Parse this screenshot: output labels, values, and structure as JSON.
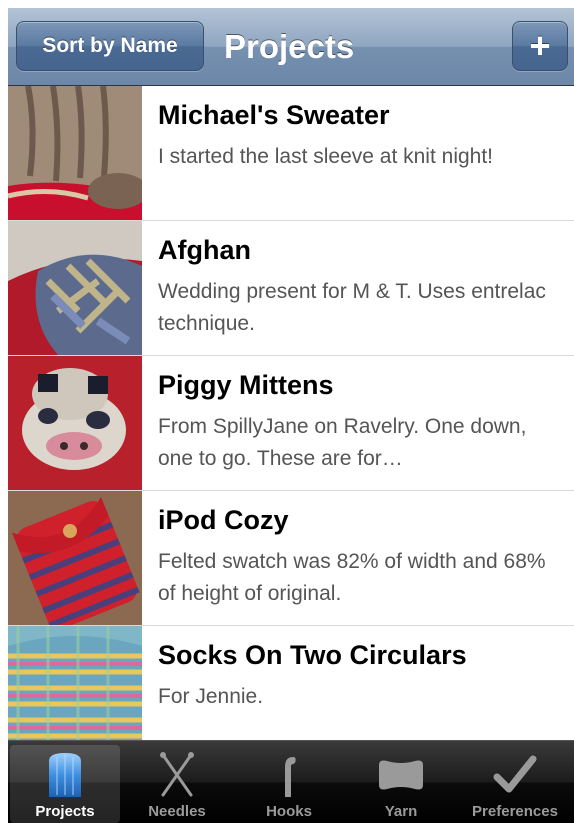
{
  "nav": {
    "sort_label": "Sort by Name",
    "title": "Projects",
    "add_label": "+"
  },
  "projects": [
    {
      "title": "Michael's Sweater",
      "description": "I started the last sleeve at knit night!"
    },
    {
      "title": "Afghan",
      "description": "Wedding present for M & T. Uses entrelac technique."
    },
    {
      "title": "Piggy Mittens",
      "description": "From SpillyJane on Ravelry. One down, one to go. These are for…"
    },
    {
      "title": "iPod Cozy",
      "description": "Felted swatch was 82% of width and 68% of height of original."
    },
    {
      "title": "Socks On Two Circulars",
      "description": "For Jennie."
    }
  ],
  "tabs": [
    {
      "label": "Projects",
      "icon": "projects-icon",
      "selected": true
    },
    {
      "label": "Needles",
      "icon": "needles-icon",
      "selected": false
    },
    {
      "label": "Hooks",
      "icon": "hook-icon",
      "selected": false
    },
    {
      "label": "Yarn",
      "icon": "yarn-icon",
      "selected": false
    },
    {
      "label": "Preferences",
      "icon": "checkmark-icon",
      "selected": false
    }
  ],
  "colors": {
    "navbar": "#7690b0",
    "tab_selected": "#3f8fe0"
  }
}
